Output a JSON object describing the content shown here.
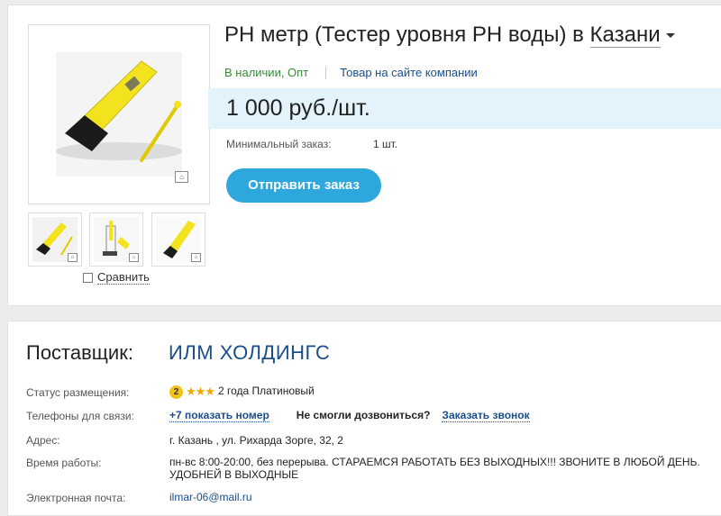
{
  "product": {
    "title_main": "РН метр (Тестер уровня РН воды) в ",
    "title_city": "Казани",
    "availability": "В наличии, Опт",
    "company_site_link": "Товар на сайте компании",
    "price": "1 000 руб./шт.",
    "min_order_label": "Минимальный заказ:",
    "min_order_value": "1 шт.",
    "order_button": "Отправить заказ",
    "compare_label": "Сравнить",
    "zoom_glyph": "⌂"
  },
  "supplier": {
    "label": "Поставщик:",
    "name": "ИЛМ ХОЛДИНГС",
    "status_label": "Статус размещения:",
    "status_level": "2",
    "status_stars": "★★★",
    "status_text": "2 года Платиновый",
    "phones_label": "Телефоны для связи:",
    "phone_link": "+7 показать номер",
    "no_call_text": "Не смогли дозвониться?",
    "callback_link": "Заказать звонок",
    "address_label": "Адрес:",
    "address_value": "г. Казань , ул. Рихарда Зорге, 32, 2",
    "hours_label": "Время работы:",
    "hours_line1": "пн-вс 8:00-20:00, без перерыва. СТАРАЕМСЯ РАБОТАТЬ БЕЗ ВЫХОДНЫХ!!! ЗВОНИТЕ В ЛЮБОЙ ДЕНЬ.",
    "hours_line2": "УДОБНЕЙ В ВЫХОДНЫЕ",
    "email_label": "Электронная почта:",
    "email_value": "ilmar-06@mail.ru"
  },
  "colors": {
    "accent": "#2ea7dc",
    "link": "#1a4d8c",
    "stock_green": "#3a8a3a",
    "price_band": "#e3f3fb"
  }
}
